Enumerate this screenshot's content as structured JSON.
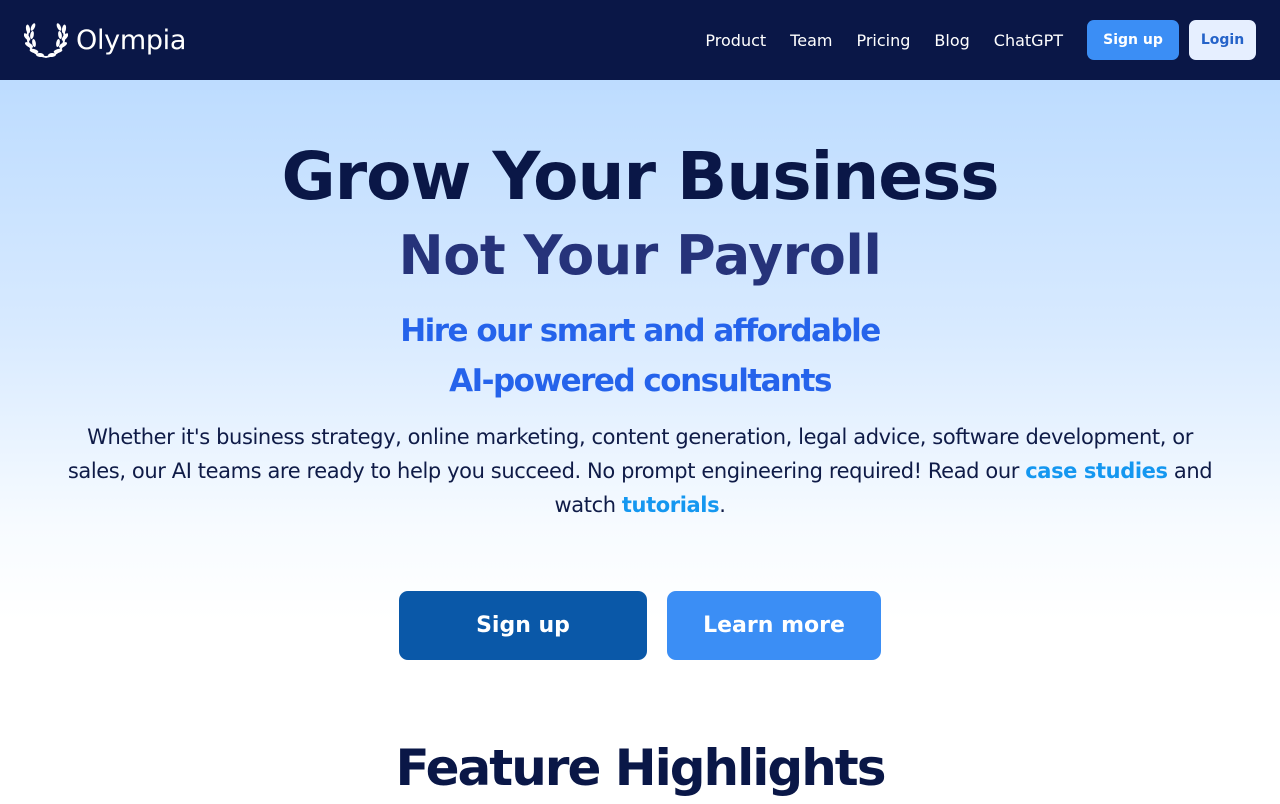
{
  "header": {
    "brand_name": "Olympia",
    "brand_icon": "laurel-wreath-icon",
    "nav": [
      {
        "label": "Product"
      },
      {
        "label": "Team"
      },
      {
        "label": "Pricing"
      },
      {
        "label": "Blog"
      },
      {
        "label": "ChatGPT"
      }
    ],
    "signup_label": "Sign up",
    "login_label": "Login"
  },
  "hero": {
    "title": "Grow Your Business",
    "subtitle": "Not Your Payroll",
    "tagline_line1": "Hire our smart and affordable",
    "tagline_line2": "AI-powered consultants",
    "desc_part1": "Whether it's business strategy, online marketing, content generation, legal advice, software development, or sales, our AI teams are ready to help you succeed. No prompt engineering required! Read our ",
    "desc_link_case": "case studies",
    "desc_part2": " and watch ",
    "desc_link_tutorials": "tutorials",
    "desc_part3": ".",
    "cta_signup": "Sign up",
    "cta_learn": "Learn more"
  },
  "features": {
    "heading": "Feature Highlights"
  },
  "colors": {
    "navbar": "#0a1747",
    "accent": "#3b8ef5",
    "primary_cta": "#0a58a8",
    "link": "#1497f0",
    "tagline": "#2563eb"
  }
}
